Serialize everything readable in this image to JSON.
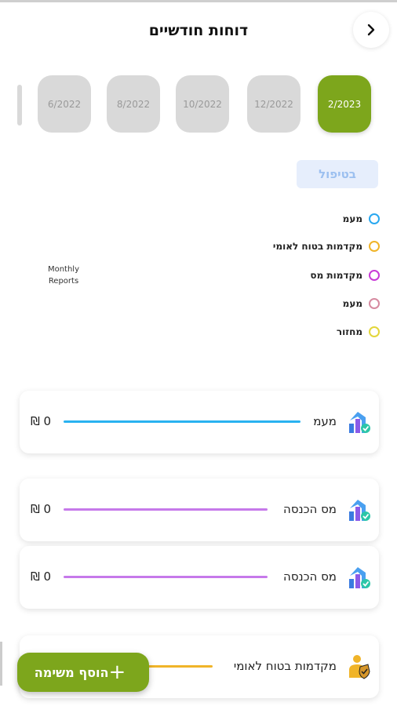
{
  "header": {
    "title": "דוחות חודשיים",
    "back_icon": "chevron-right-icon"
  },
  "months": [
    {
      "label": "2/2023",
      "active": true
    },
    {
      "label": "12/2022",
      "active": false
    },
    {
      "label": "10/2022",
      "active": false
    },
    {
      "label": "8/2022",
      "active": false
    },
    {
      "label": "6/2022",
      "active": false
    }
  ],
  "status": {
    "label": "בטיפול"
  },
  "legend": [
    {
      "label": "מעמ",
      "color": "#29a8f0"
    },
    {
      "label": "מקדמות בטוח לאומי",
      "color": "#f0b429"
    },
    {
      "label": "מקדמות מס",
      "color": "#c83ad6"
    },
    {
      "label": "מעמ",
      "color": "#d68aa0"
    },
    {
      "label": "מחזור",
      "color": "#e3d63a"
    }
  ],
  "chart": {
    "caption": "Monthly Reports"
  },
  "cards": [
    {
      "label": "מעמ",
      "amount": "0 ₪",
      "color": "#29b2f0",
      "icon": "growth-chart-icon"
    },
    {
      "label": "מס הכנסה",
      "amount": "0 ₪",
      "color": "#c679ea",
      "icon": "growth-chart-icon"
    },
    {
      "label": "מס הכנסה",
      "amount": "0 ₪",
      "color": "#c679ea",
      "icon": "growth-chart-icon"
    },
    {
      "label": "מקדמות בטוח לאומי",
      "amount": "",
      "color": "#f0b429",
      "icon": "person-shield-icon"
    }
  ],
  "fab": {
    "label": "הוסף משימה",
    "icon": "plus-icon"
  },
  "colors": {
    "accent": "#7da61c",
    "chip_bg": "#e6eefc",
    "chip_text": "#9cc0f0"
  }
}
